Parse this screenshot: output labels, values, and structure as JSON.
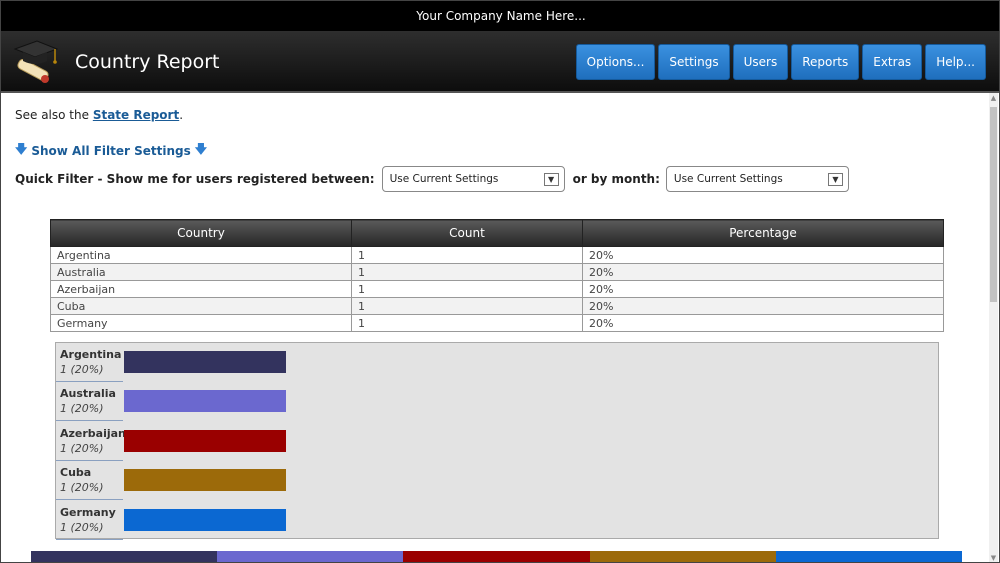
{
  "company_name": "Your Company Name Here...",
  "page_title": "Country Report",
  "nav": [
    {
      "label": "Options..."
    },
    {
      "label": "Settings"
    },
    {
      "label": "Users"
    },
    {
      "label": "Reports"
    },
    {
      "label": "Extras"
    },
    {
      "label": "Help..."
    }
  ],
  "see_also": {
    "prefix": "See also the ",
    "link": "State Report",
    "suffix": "."
  },
  "filter_toggle": "Show All Filter Settings",
  "quick_filter": {
    "label": "Quick Filter - Show me for users registered between:",
    "date_value": "Use Current Settings",
    "or_label": "or by month:",
    "month_value": "Use Current Settings"
  },
  "table": {
    "headers": [
      "Country",
      "Count",
      "Percentage"
    ],
    "rows": [
      [
        "Argentina",
        "1",
        "20%"
      ],
      [
        "Australia",
        "1",
        "20%"
      ],
      [
        "Azerbaijan",
        "1",
        "20%"
      ],
      [
        "Cuba",
        "1",
        "20%"
      ],
      [
        "Germany",
        "1",
        "20%"
      ]
    ]
  },
  "chart_data": {
    "type": "bar",
    "orientation": "horizontal",
    "categories": [
      "Argentina",
      "Australia",
      "Azerbaijan",
      "Cuba",
      "Germany"
    ],
    "values": [
      1,
      1,
      1,
      1,
      1
    ],
    "value_labels": [
      "1 (20%)",
      "1 (20%)",
      "1 (20%)",
      "1 (20%)",
      "1 (20%)"
    ],
    "colors": [
      "#33335e",
      "#6b68cf",
      "#9a0000",
      "#9c6a0a",
      "#0b68d2"
    ],
    "title": "",
    "xlabel": "",
    "ylabel": ""
  },
  "stacked_bar": {
    "fractions": [
      0.2,
      0.2,
      0.2,
      0.2,
      0.2
    ],
    "colors": [
      "#33335e",
      "#6b68cf",
      "#9a0000",
      "#9c6a0a",
      "#0b68d2"
    ]
  }
}
